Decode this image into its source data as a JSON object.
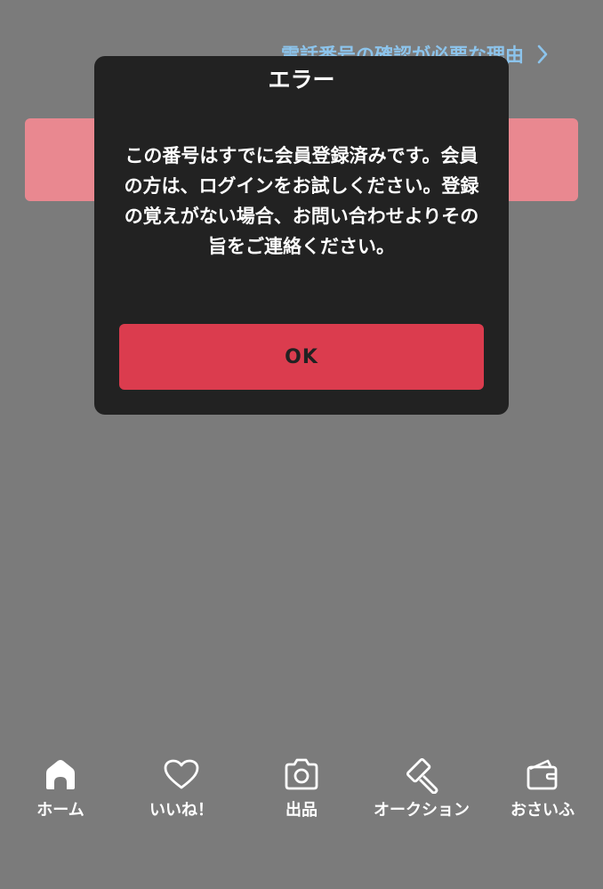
{
  "header": {
    "link_text": "電話番号の確認が必要な理由",
    "link_icon": "chevron-right-icon"
  },
  "dialog": {
    "title": "エラー",
    "message": "この番号はすでに会員登録済みです。会員の方は、ログインをお試しください。登録の覚えがない場合、お問い合わせよりその旨をご連絡ください。",
    "ok_label": "OK"
  },
  "tabbar": {
    "items": [
      {
        "label": "ホーム",
        "icon": "home-icon"
      },
      {
        "label": "いいね！",
        "icon": "heart-icon"
      },
      {
        "label": "出品",
        "icon": "camera-icon"
      },
      {
        "label": "オークション",
        "icon": "gavel-icon"
      },
      {
        "label": "おさいふ",
        "icon": "wallet-icon"
      }
    ]
  },
  "colors": {
    "overlay": "#7b7b7b",
    "dialog_bg": "#222222",
    "accent": "#db3c4e",
    "pink_button": "#e98890",
    "link": "#8cc4ec"
  }
}
